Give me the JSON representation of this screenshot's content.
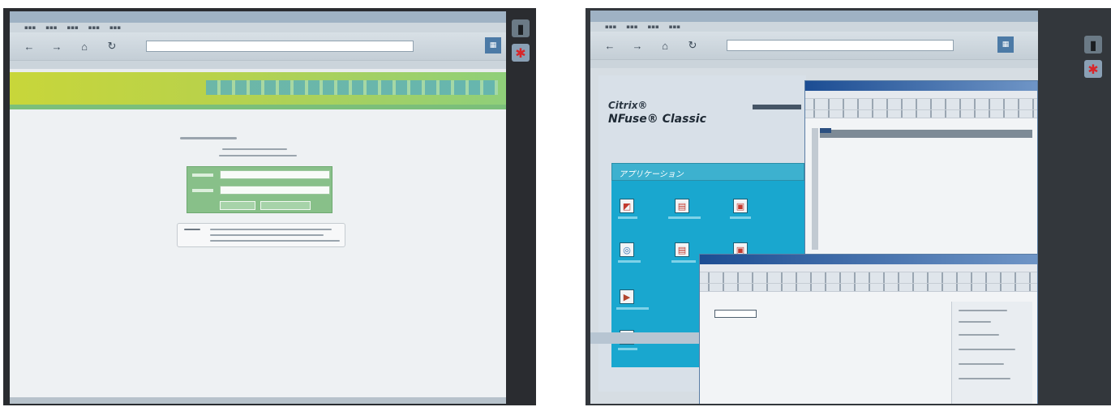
{
  "left_photo": {
    "browser": {
      "title_text": "",
      "address_text": "",
      "go_label": ""
    }
  },
  "right_photo": {
    "nfuse": {
      "logo_line1": "Citrix®",
      "logo_line2": "NFuse® Classic",
      "apps_title": "アプリケーション"
    }
  },
  "colors": {
    "banner_yellow_green": "#c8d63a",
    "login_green": "#88c089",
    "apps_cyan": "#19a7cf",
    "window_title_blue": "#1c4d93"
  }
}
